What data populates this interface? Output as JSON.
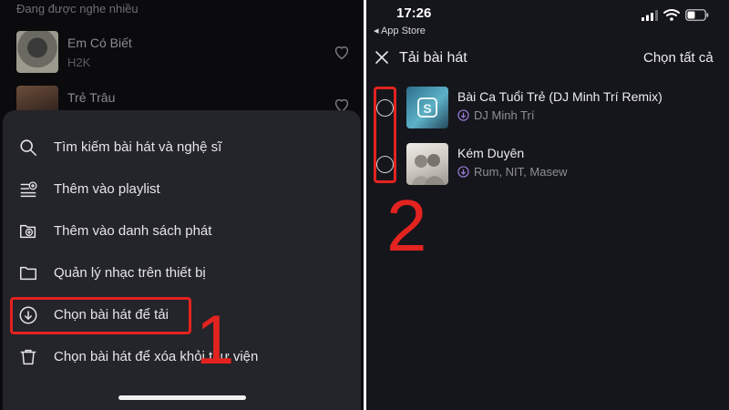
{
  "left": {
    "section_label": "Đang được nghe nhiều",
    "songs": [
      {
        "title": "Em Có Biết",
        "artist": "H2K"
      },
      {
        "title": "Trẻ Trâu",
        "artist": ""
      }
    ],
    "menu": [
      {
        "icon": "search-icon",
        "label": "Tìm kiếm bài hát và nghệ sĩ"
      },
      {
        "icon": "add-to-playlist-icon",
        "label": "Thêm vào playlist"
      },
      {
        "icon": "add-to-queue-icon",
        "label": "Thêm vào danh sách phát"
      },
      {
        "icon": "folder-icon",
        "label": "Quản lý nhạc trên thiết bị"
      },
      {
        "icon": "download-icon",
        "label": "Chọn bài hát để tải"
      },
      {
        "icon": "trash-icon",
        "label": "Chọn bài hát để xóa khỏi thư viện"
      }
    ],
    "step_label": "1"
  },
  "right": {
    "status": {
      "time": "17:26",
      "back_label": "◂ App Store"
    },
    "header": {
      "title": "Tải bài hát",
      "select_all": "Chọn tất cả"
    },
    "songs": [
      {
        "title": "Bài Ca Tuổi Trẻ (DJ Minh Trí Remix)",
        "artist": "DJ Minh Trí"
      },
      {
        "title": "Kém Duyên",
        "artist": "Rum, NIT, Masew"
      }
    ],
    "step_label": "2"
  },
  "colors": {
    "highlight": "#e3231f",
    "sheet_bg": "#24242b",
    "panel_bg": "#15161c",
    "accent": "#9b7bd6"
  }
}
